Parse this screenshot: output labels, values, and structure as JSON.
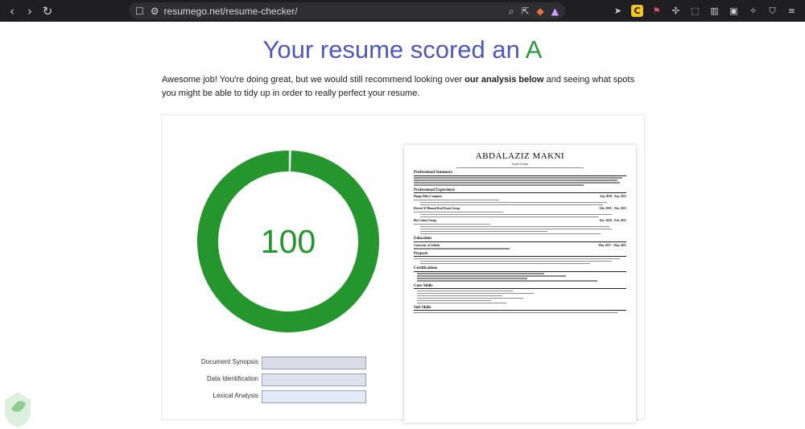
{
  "browser": {
    "url": "resumego.net/resume-checker/"
  },
  "page": {
    "headline_prefix": "Your resume scored an ",
    "headline_grade": "A",
    "intro_start": "Awesome job! You're doing great, but we would still recommend looking over ",
    "intro_bold": "our analysis below",
    "intro_end": " and seeing what spots you might be able to tidy up in order to really perfect your resume."
  },
  "score": {
    "value": "100",
    "fraction": 1.0,
    "ring_color": "#25952e",
    "track_color": "#e6e6e6"
  },
  "metrics": [
    {
      "label": "Document Synopsis"
    },
    {
      "label": "Data Identification"
    },
    {
      "label": "Lexical Analysis"
    }
  ],
  "resume": {
    "name": "ABDALAZIZ MAKNI",
    "location": "Saudi Arabia",
    "sections": {
      "summary": "Professional Summary",
      "experience": "Professional Experience",
      "education": "Education",
      "projects": "Projects",
      "certifications": "Certifications",
      "skills": "Core Skills",
      "soft_skills": "Soft Skills"
    },
    "experience": [
      {
        "company": "Happy Baby Company",
        "dates": "Sep. 2018 – Sep. 2021"
      },
      {
        "company": "Durrat Al Mamad Real Estate Group",
        "dates": "Feb. 2018 – Nov. 2021"
      },
      {
        "company": "Bin Ladem Group",
        "dates": "Nov. 2020 – Feb. 2021"
      }
    ],
    "education": [
      {
        "school": "University of Jeddah",
        "dates": "Mar. 2017 – Mar. 2021"
      }
    ]
  }
}
